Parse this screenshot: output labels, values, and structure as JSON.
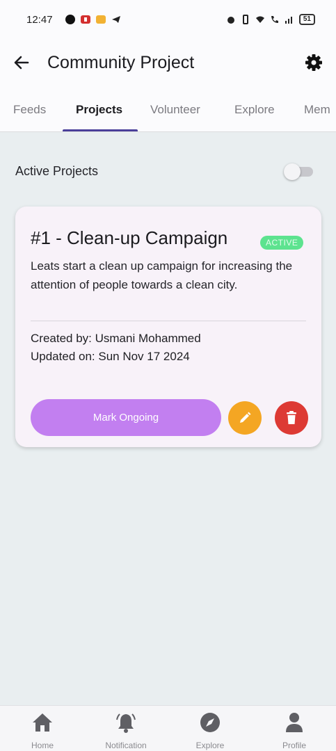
{
  "status_bar": {
    "time": "12:47",
    "battery": "51"
  },
  "app_bar": {
    "title": "Community Project"
  },
  "tabs": [
    {
      "label": "Feeds"
    },
    {
      "label": "Projects"
    },
    {
      "label": "Volunteer"
    },
    {
      "label": "Explore"
    },
    {
      "label": "Mem"
    }
  ],
  "active_tab": "Projects",
  "filter": {
    "label": "Active Projects",
    "enabled": false
  },
  "project_card": {
    "title": "#1 - Clean-up Campaign",
    "status": "ACTIVE",
    "description": "Leats start a clean up campaign for increasing the attention of people towards a clean city.",
    "created_by": "Created by: Usmani Mohammed",
    "updated_on": "Updated on: Sun Nov 17 2024",
    "primary_action": "Mark Ongoing"
  },
  "bottom_nav": [
    {
      "label": "Home",
      "icon": "home-icon"
    },
    {
      "label": "Notification",
      "icon": "bell-icon"
    },
    {
      "label": "Explore",
      "icon": "compass-icon"
    },
    {
      "label": "Profile",
      "icon": "person-icon"
    }
  ],
  "colors": {
    "accent": "#4a3f9a",
    "mark_button": "#c27ff0",
    "edit_button": "#f4a623",
    "delete_button": "#dd3a34",
    "status_active": "#5de38f"
  }
}
